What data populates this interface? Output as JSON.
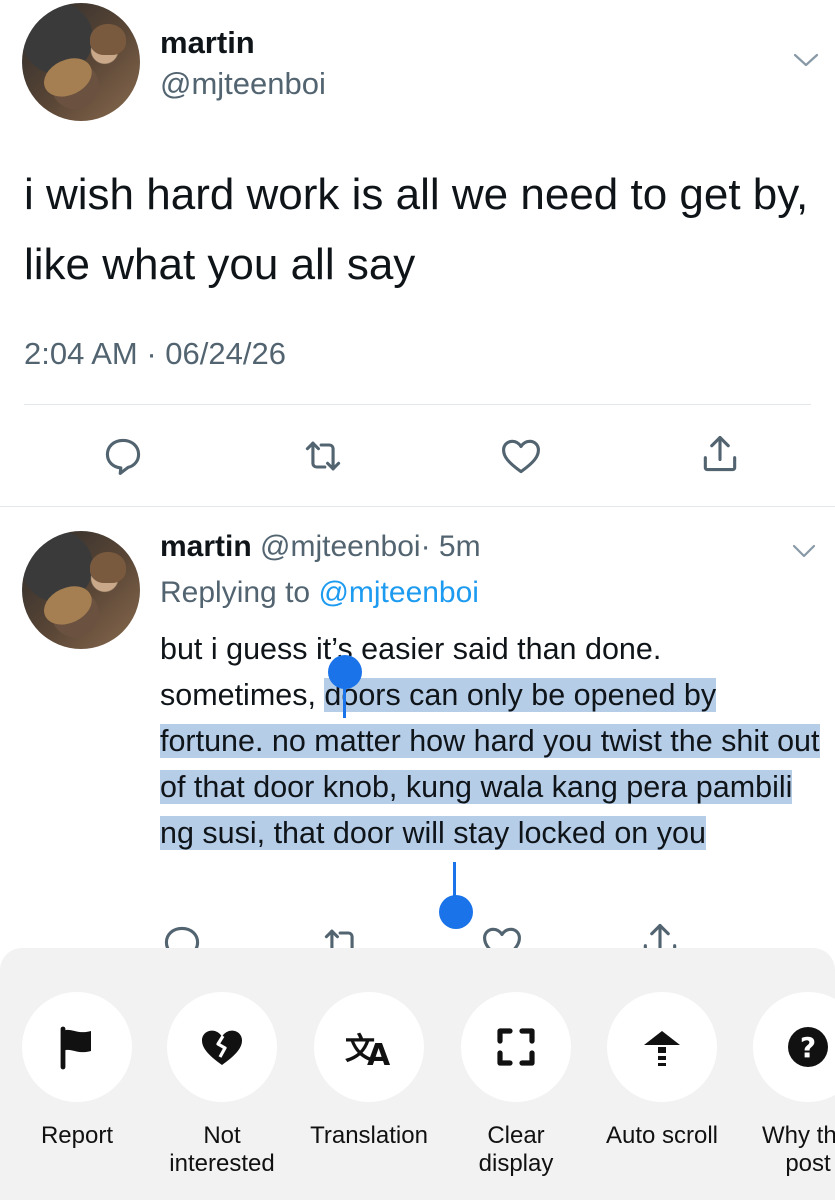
{
  "tweet": {
    "author_name": "martin",
    "author_handle": "@mjteenboi",
    "text": "i wish hard work is all we need to get by, like what you all say",
    "timestamp": "2:04 AM · 06/24/26"
  },
  "reply": {
    "author_name": "martin",
    "author_handle": "@mjteenboi",
    "time": "· 5m",
    "replying_prefix": "Replying to ",
    "replying_to": "@mjteenboi",
    "text_before_selection": "but i guess it’s easier said than done. sometimes, ",
    "selected_text": "doors can only be opened by fortune. no matter how hard you twist the shit out of that door knob, kung wala kang pera pambili ng susi, that door will stay locked on you"
  },
  "actions": [
    "reply-icon",
    "retweet-icon",
    "like-icon",
    "share-icon"
  ],
  "sheet": {
    "items": [
      {
        "label": "Report",
        "icon": "flag-icon"
      },
      {
        "label": "Not\ninterested",
        "icon": "broken-heart-icon"
      },
      {
        "label": "Translation",
        "icon": "translate-icon"
      },
      {
        "label": "Clear\ndisplay",
        "icon": "fullscreen-icon"
      },
      {
        "label": "Auto scroll",
        "icon": "auto-scroll-icon"
      },
      {
        "label": "Why this\npost",
        "icon": "question-icon"
      }
    ]
  },
  "colors": {
    "selection": "#b6cde8",
    "handle": "#1a73e8",
    "link": "#1d9bf0",
    "secondary_text": "#536471",
    "icon": "#536471"
  }
}
